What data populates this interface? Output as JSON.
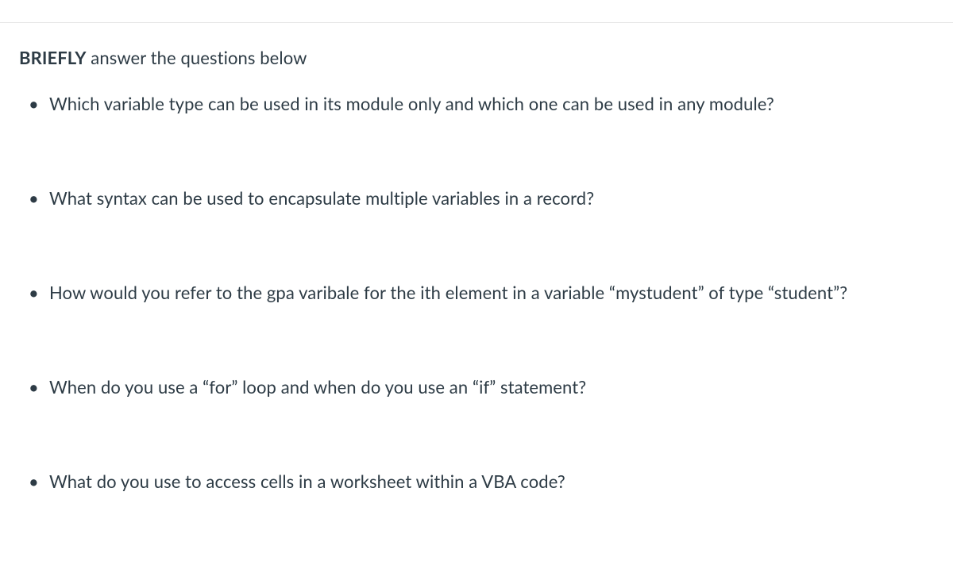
{
  "heading": {
    "bold": "BRIEFLY",
    "rest": " answer the questions below"
  },
  "questions": [
    "Which variable type can be used in its module only and which one can be used in any module?",
    "What syntax can be used to encapsulate multiple variables in a record?",
    "How would you refer to the gpa varibale for the ith element in a variable “mystudent” of type “student”?",
    "When do you use a “for” loop and when do you use an “if” statement?",
    "What do you use to access cells in a worksheet within a VBA code?"
  ]
}
